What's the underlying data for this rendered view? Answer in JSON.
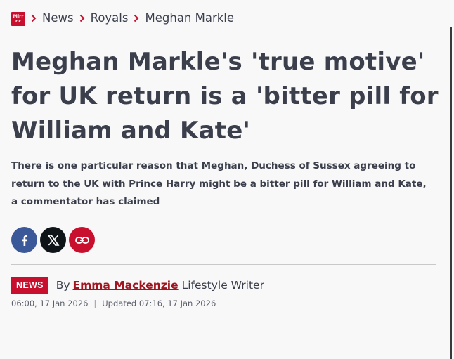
{
  "breadcrumb": {
    "logo_text": "Mirror",
    "items": [
      {
        "label": "News"
      },
      {
        "label": "Royals"
      },
      {
        "label": "Meghan Markle"
      }
    ]
  },
  "article": {
    "headline": "Meghan Markle's 'true motive' for UK return is a 'bitter pill for William and Kate'",
    "standfirst": "There is one particular reason that Meghan, Duchess of Sussex agreeing to return to the UK with Prince Harry might be a bitter pill for William and Kate, a commentator has claimed"
  },
  "share": {
    "buttons": [
      {
        "icon": "facebook-icon",
        "color": "#3b5998"
      },
      {
        "icon": "x-icon",
        "color": "#0f1419"
      },
      {
        "icon": "link-icon",
        "color": "#c8102e"
      }
    ]
  },
  "byline": {
    "tag": "NEWS",
    "by": "By",
    "author": "Emma Mackenzie",
    "role": "Lifestyle Writer",
    "published": "06:00, 17 Jan 2026",
    "separator": "|",
    "updated": "Updated 07:16, 17 Jan 2026"
  },
  "colors": {
    "brand_red": "#c8102e",
    "text": "#3b3f4c",
    "author_link": "#a0151f"
  }
}
